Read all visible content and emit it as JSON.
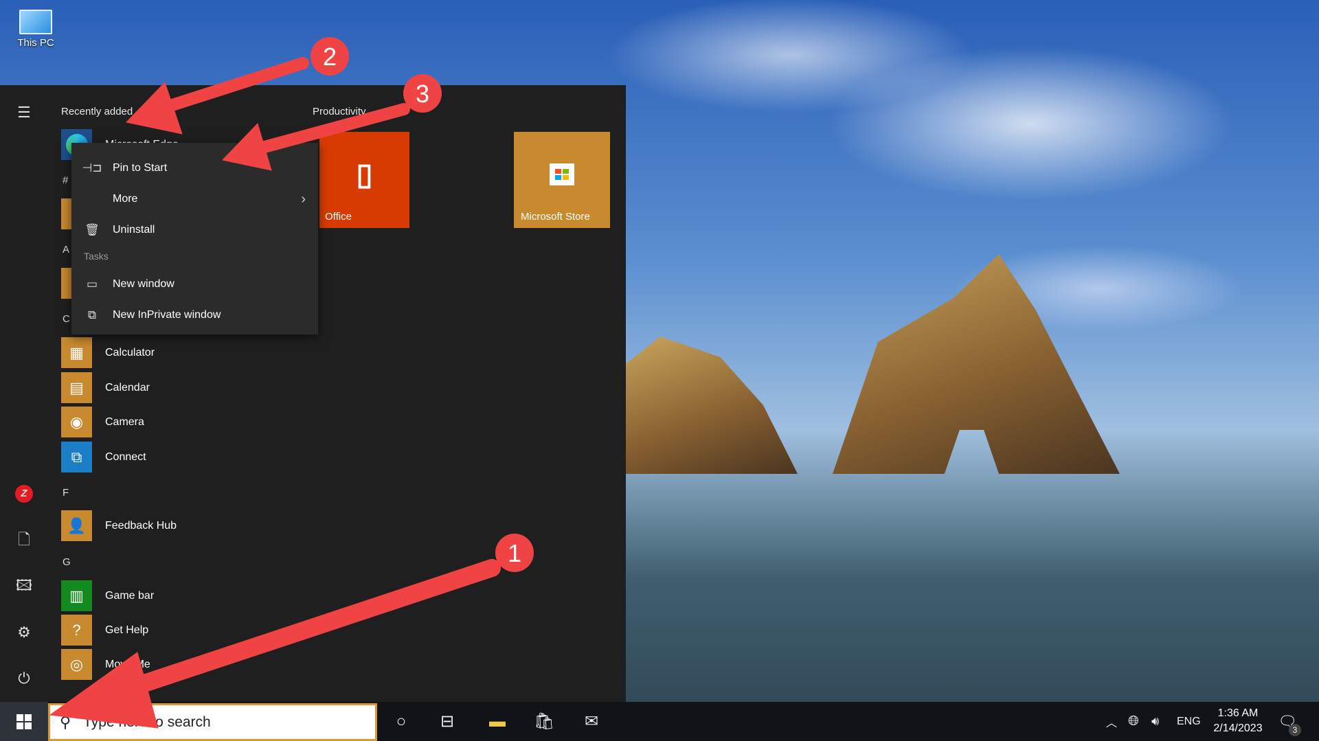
{
  "desktop": {
    "icons": [
      {
        "label": "This PC",
        "icon": "this-pc-icon"
      }
    ]
  },
  "start_menu": {
    "recently_added_header": "Recently added",
    "recent_app": "Microsoft Edge",
    "group_letters": [
      "#",
      "A",
      "C",
      "F",
      "G"
    ],
    "apps": [
      {
        "label": "Calculator",
        "icon": "calculator-icon",
        "color": "#c8892f"
      },
      {
        "label": "Calendar",
        "icon": "calendar-icon",
        "color": "#c8892f"
      },
      {
        "label": "Camera",
        "icon": "camera-icon",
        "color": "#c8892f"
      },
      {
        "label": "Connect",
        "icon": "connect-icon",
        "color": "#1a7fc7"
      },
      {
        "label": "Feedback Hub",
        "icon": "feedback-icon",
        "color": "#c8892f"
      },
      {
        "label": "Game bar",
        "icon": "gamebar-icon",
        "color": "#138a1e"
      },
      {
        "label": "Get Help",
        "icon": "help-icon",
        "color": "#c8892f"
      },
      {
        "label": "Move Me",
        "icon": "target-icon",
        "color": "#c8892f"
      }
    ],
    "tiles_header": "Productivity",
    "tiles": [
      {
        "label": "Office",
        "color": "#d83b01"
      },
      {
        "label": "Microsoft Store",
        "color": "#c8892f"
      }
    ]
  },
  "context_menu": {
    "items": [
      {
        "label": "Pin to Start",
        "icon": "pin-icon"
      },
      {
        "label": "More",
        "icon": "chevron-right-icon"
      },
      {
        "label": "Uninstall",
        "icon": "trash-icon"
      }
    ],
    "section": "Tasks",
    "tasks": [
      {
        "label": "New window",
        "icon": "window-icon"
      },
      {
        "label": "New InPrivate window",
        "icon": "inprivate-icon"
      }
    ]
  },
  "annotations": {
    "labels": [
      "1",
      "2",
      "3"
    ],
    "color": "#f04444"
  },
  "taskbar": {
    "search_placeholder": "Type here to search",
    "tray": {
      "language": "ENG",
      "time": "1:36 AM",
      "date": "2/14/2023",
      "notifications": "3"
    }
  }
}
